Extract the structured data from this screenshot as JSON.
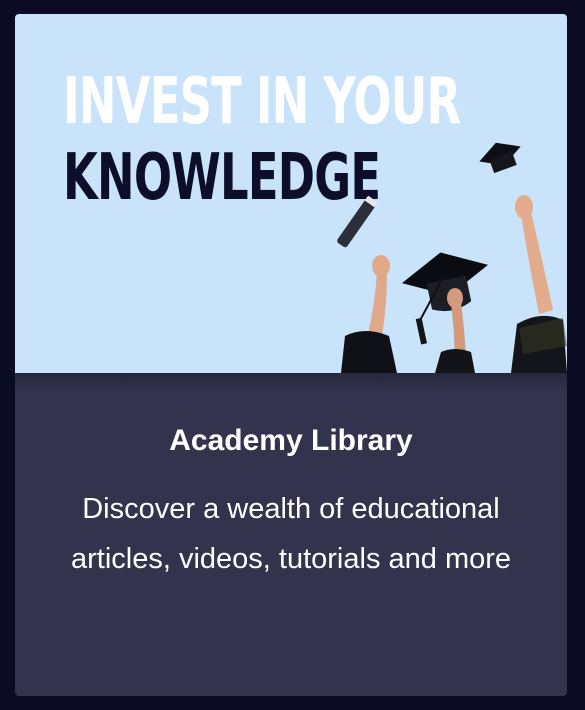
{
  "card": {
    "headline_line1": "INVEST IN YOUR",
    "headline_line2": "KNOWLEDGE",
    "title": "Academy Library",
    "description": "Discover a wealth of educational articles, videos, tutorials and more"
  },
  "colors": {
    "page_background": "#0b0b24",
    "card_background": "#33334d",
    "hero_background": "#c9e4fa",
    "headline_dark": "#0d0f2a",
    "text": "#ffffff"
  },
  "icons": {
    "hero_illustration": "graduation-caps-thrown-icon"
  }
}
